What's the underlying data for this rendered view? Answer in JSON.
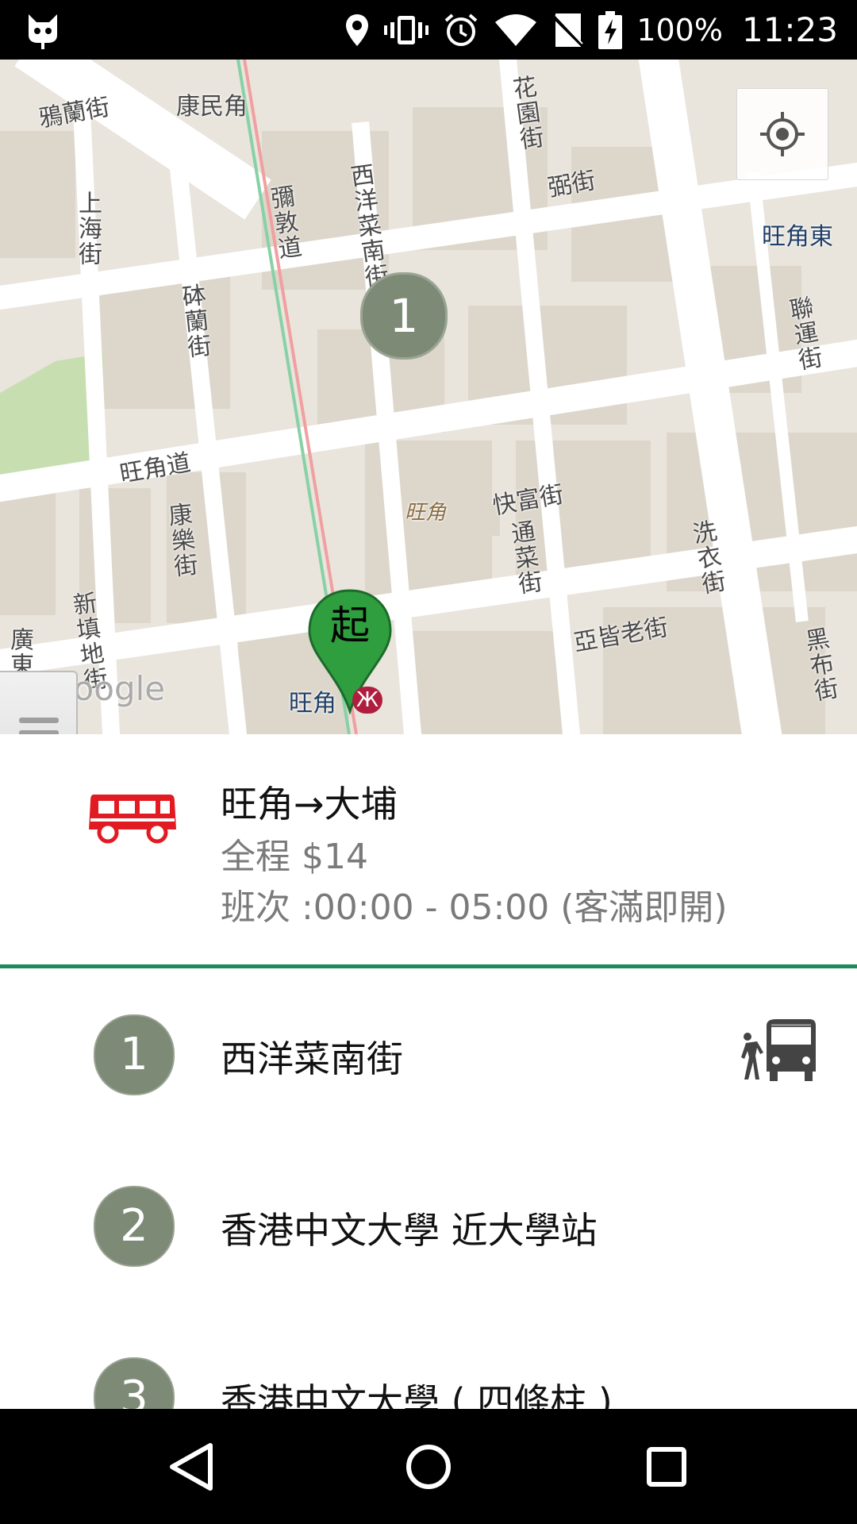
{
  "status_bar": {
    "battery_percent": "100%",
    "time": "11:23",
    "icons": [
      "cat-notification-icon",
      "location-icon",
      "vibrate-icon",
      "alarm-icon",
      "wifi-icon",
      "no-sim-icon",
      "battery-charging-icon"
    ]
  },
  "map": {
    "labels": {
      "yalan": "鴉蘭街",
      "hongmingok": "康民角",
      "shanghai": "上海街",
      "nelson_road": "彌敦道",
      "sai_yeung_choi_south": "西洋菜南街",
      "fa_yuen": "花園街",
      "bute": "弼街",
      "mong_kok_east": "旺角東",
      "luen_wan": "聯運街",
      "canton": "砵蘭街",
      "mong_kok_road": "旺角道",
      "mong_kok_italic": "旺角",
      "fife": "快富街",
      "tung_choi": "通菜街",
      "sai_yee": "洗衣街",
      "hong_lok": "康樂街",
      "sun_tin_wai": "新填地街",
      "argyle": "亞皆老街",
      "kwong": "廣東",
      "black": "黑布街",
      "mong_kok_station": "旺角",
      "google_watermark": "Google"
    },
    "stop_marker_number": "1",
    "start_pin_label": "起",
    "mtr_symbol": "Ж",
    "locate_icon": "my-location-icon"
  },
  "route": {
    "title": "旺角→大埔",
    "fare": "全程 $14",
    "schedule": "班次 :00:00 - 05:00 (客滿即開)",
    "vehicle_icon": "minibus-icon",
    "vehicle_color": "#e21b23"
  },
  "stops": [
    {
      "number": "1",
      "name": "西洋菜南街",
      "has_walk_bus_icon": true
    },
    {
      "number": "2",
      "name": "香港中文大學 近大學站"
    },
    {
      "number": "3",
      "name": "香港中文大學 ( 四條柱 )"
    }
  ],
  "colors": {
    "accent_green": "#1c8a5a",
    "stop_marker": "#7d8a76",
    "pin_green": "#2e9e3f"
  },
  "nav": {
    "back_icon": "back-triangle-icon",
    "home_icon": "home-circle-icon",
    "recents_icon": "recents-square-icon"
  }
}
